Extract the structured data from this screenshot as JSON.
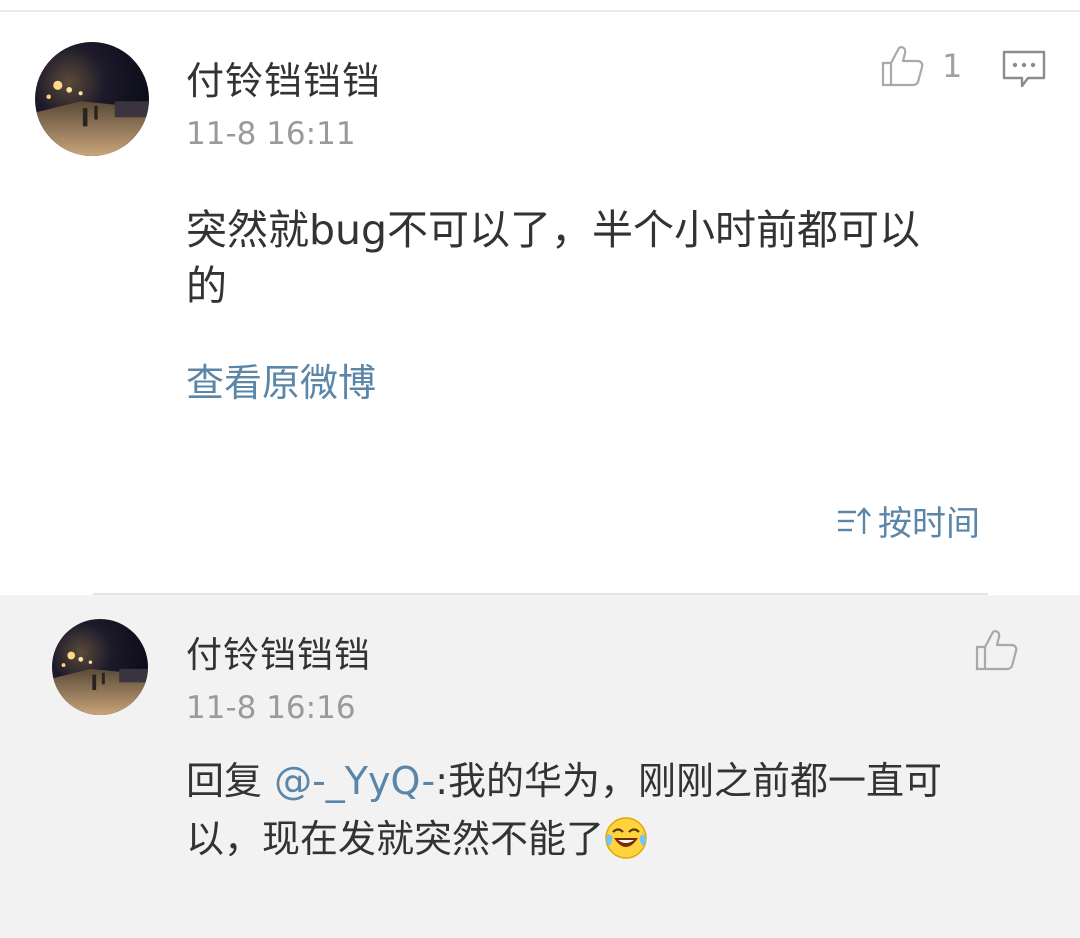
{
  "comment": {
    "username": "付铃铛铛铛",
    "time": "11-8 16:11",
    "like_icon": "thumbs-up-icon",
    "like_count": "1",
    "comment_icon": "comment-bubble-icon",
    "text_line1": "突然就bug不可以了，半个小时前都可以",
    "text_line2": "的",
    "view_original": "查看原微博"
  },
  "sort": {
    "icon": "sort-icon",
    "label": "按时间"
  },
  "reply": {
    "username": "付铃铛铛铛",
    "time": "11-8 16:16",
    "like_icon": "thumbs-up-icon",
    "prefix": "回复 ",
    "mention": "@-_YyQ-",
    "text_line1": ":我的华为，刚刚之前都一直可",
    "text_line2": "以，现在发就突然不能了",
    "emoji": "laughing-crying-emoji"
  },
  "colors": {
    "link": "#5b86a8",
    "text": "#333333",
    "muted": "#9a9a9a",
    "reply_bg": "#f2f2f2"
  }
}
